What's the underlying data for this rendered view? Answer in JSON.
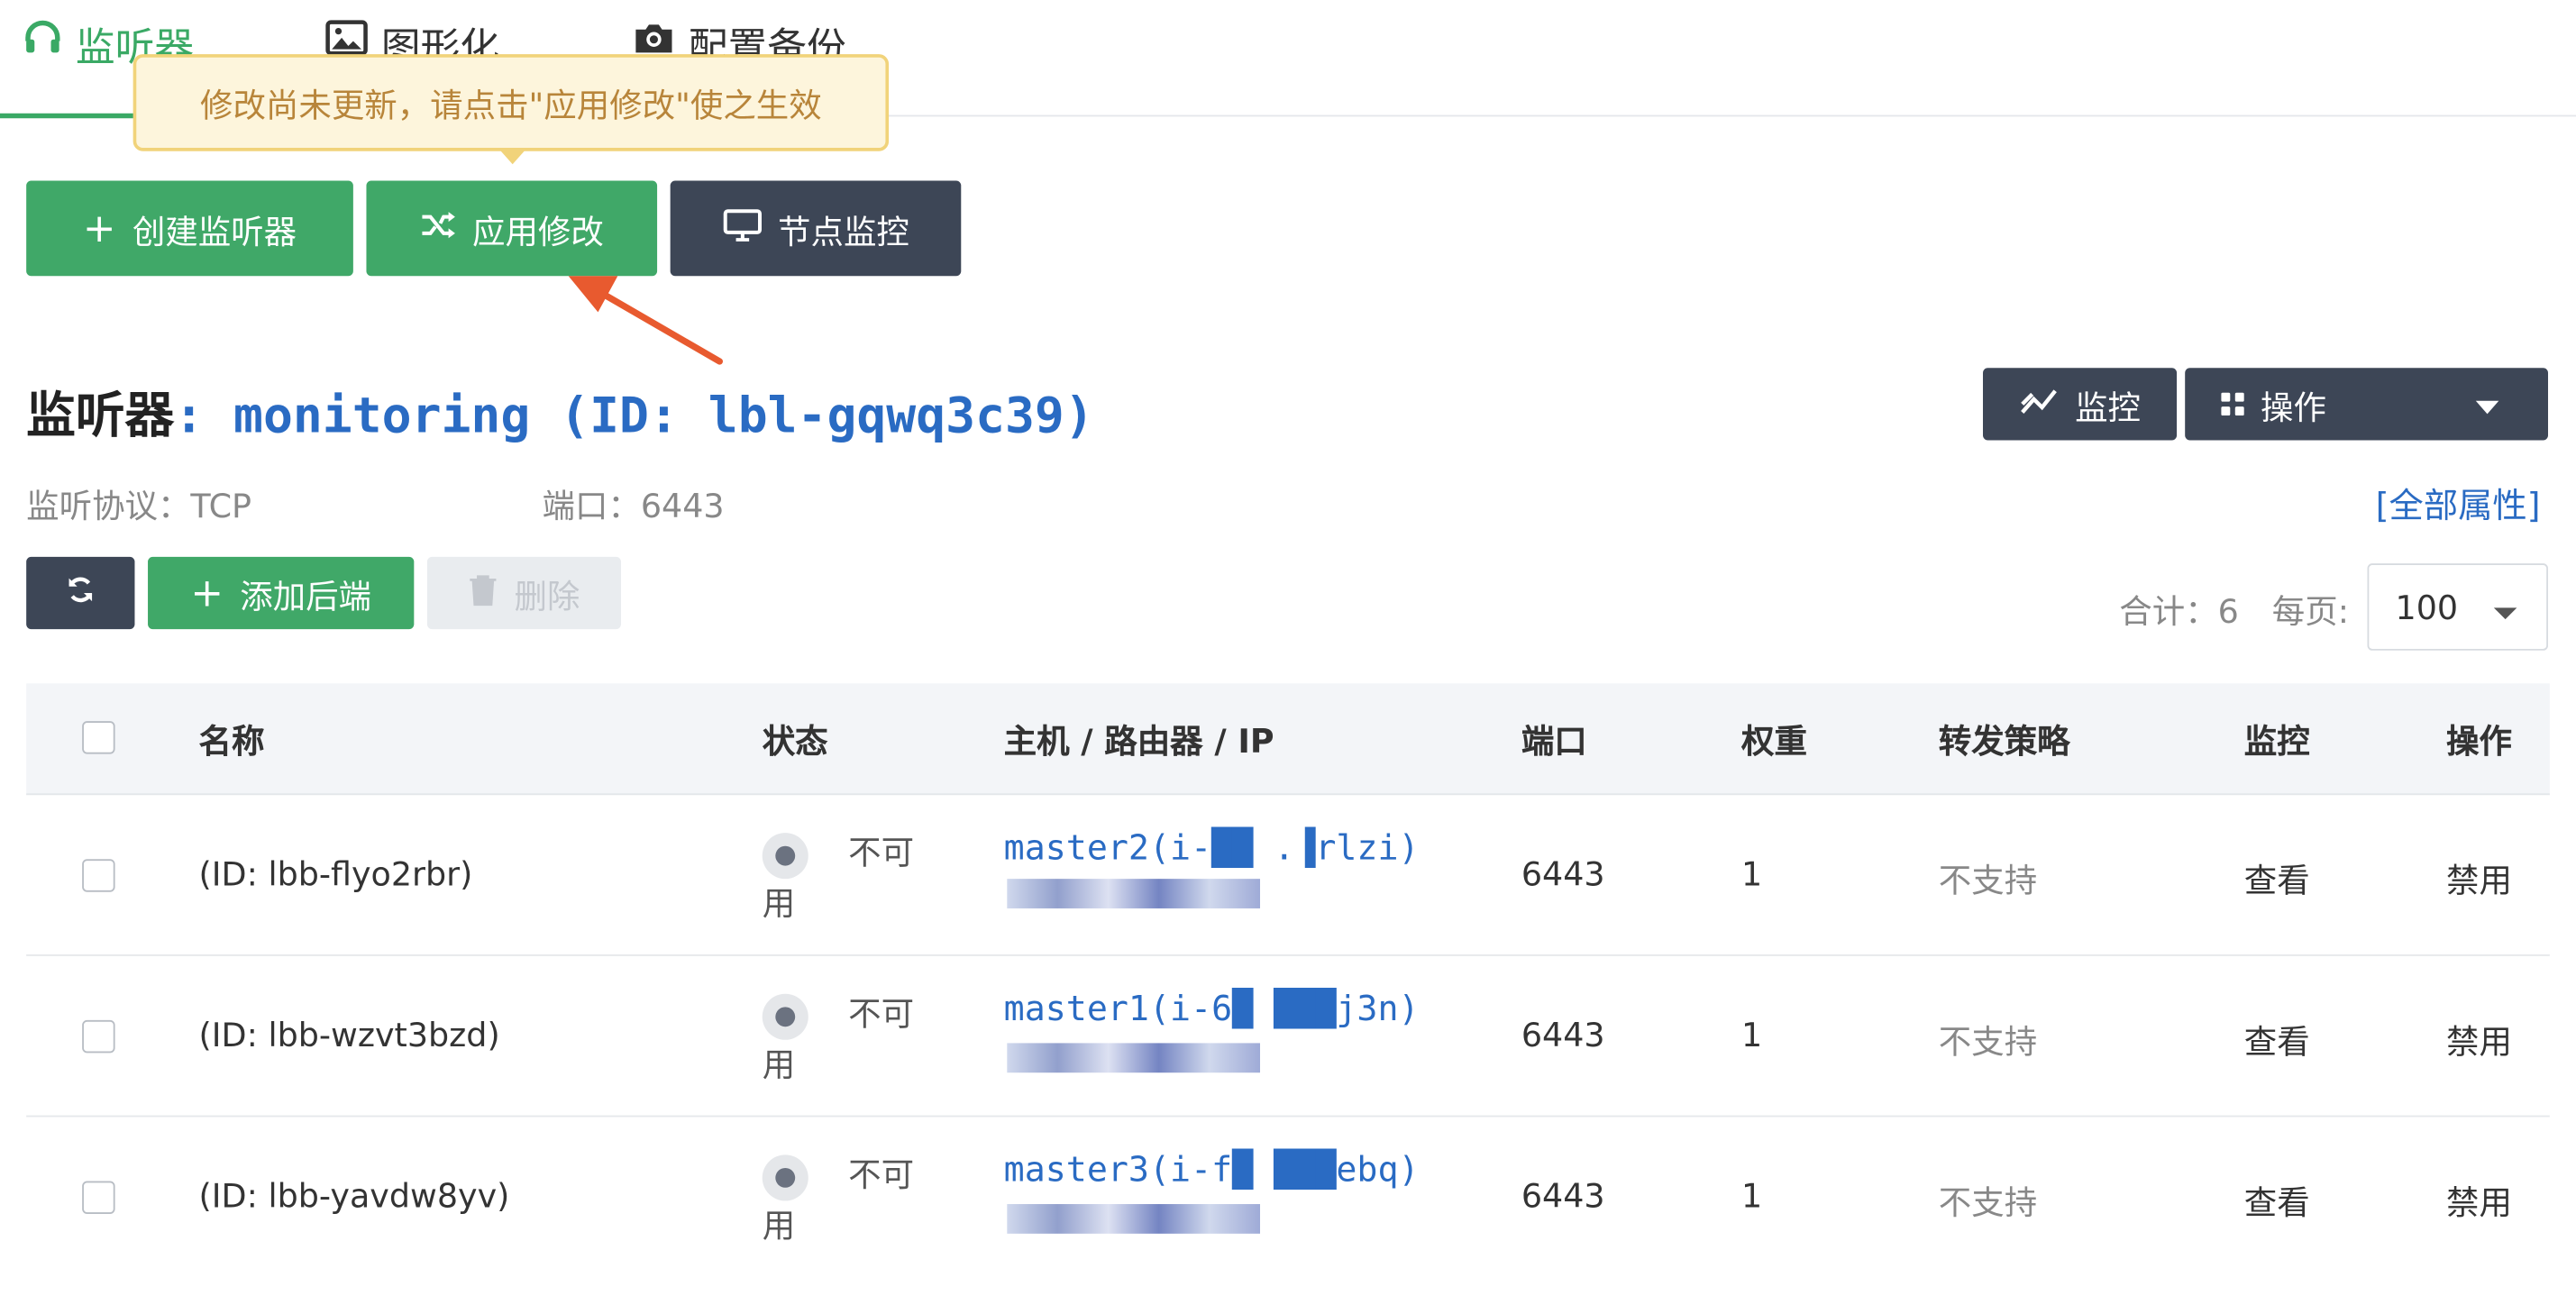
{
  "tabs": [
    {
      "label": "监听器",
      "icon": "headphones-icon",
      "active": true
    },
    {
      "label": "图形化",
      "icon": "image-icon",
      "active": false
    },
    {
      "label": "配置备份",
      "icon": "camera-icon",
      "active": false
    }
  ],
  "tooltip": "修改尚未更新，请点击\"应用修改\"使之生效",
  "toolbar": {
    "create": "创建监听器",
    "apply": "应用修改",
    "node_monitor": "节点监控"
  },
  "listener": {
    "prefix": "监听器",
    "name": " : monitoring (ID: lbl-gqwq3c39)",
    "protocol_label": "监听协议：TCP",
    "port_label": "端口：6443",
    "all_attrs": "[全部属性]",
    "monitor_btn": "监控",
    "ops_btn": "操作"
  },
  "backend_toolbar": {
    "add": "添加后端",
    "delete": "删除",
    "total": "合计：6",
    "per_page": "每页:",
    "page_size": "100"
  },
  "table": {
    "columns": [
      "名称",
      "状态",
      "主机 / 路由器 / IP",
      "端口",
      "权重",
      "转发策略",
      "监控",
      "操作"
    ],
    "rows": [
      {
        "name": "(ID: lbb-flyo2rbr)",
        "status_1": "不可",
        "status_2": "用",
        "host": "master2(i-██ .▐rlzi)",
        "port": "6443",
        "weight": "1",
        "policy": "不支持",
        "monitor": "查看",
        "action": "禁用"
      },
      {
        "name": "(ID: lbb-wzvt3bzd)",
        "status_1": "不可",
        "status_2": "用",
        "host": "master1(i-6█ ███j3n)",
        "port": "6443",
        "weight": "1",
        "policy": "不支持",
        "monitor": "查看",
        "action": "禁用"
      },
      {
        "name": "(ID: lbb-yavdw8yv)",
        "status_1": "不可",
        "status_2": "用",
        "host": "master3(i-f█ ███ebq)",
        "port": "6443",
        "weight": "1",
        "policy": "不支持",
        "monitor": "查看",
        "action": "禁用"
      }
    ]
  },
  "colors": {
    "accent_green": "#40a868",
    "dark": "#3d4656",
    "link": "#2a6bc3",
    "annotation_arrow": "#e85a2f"
  }
}
